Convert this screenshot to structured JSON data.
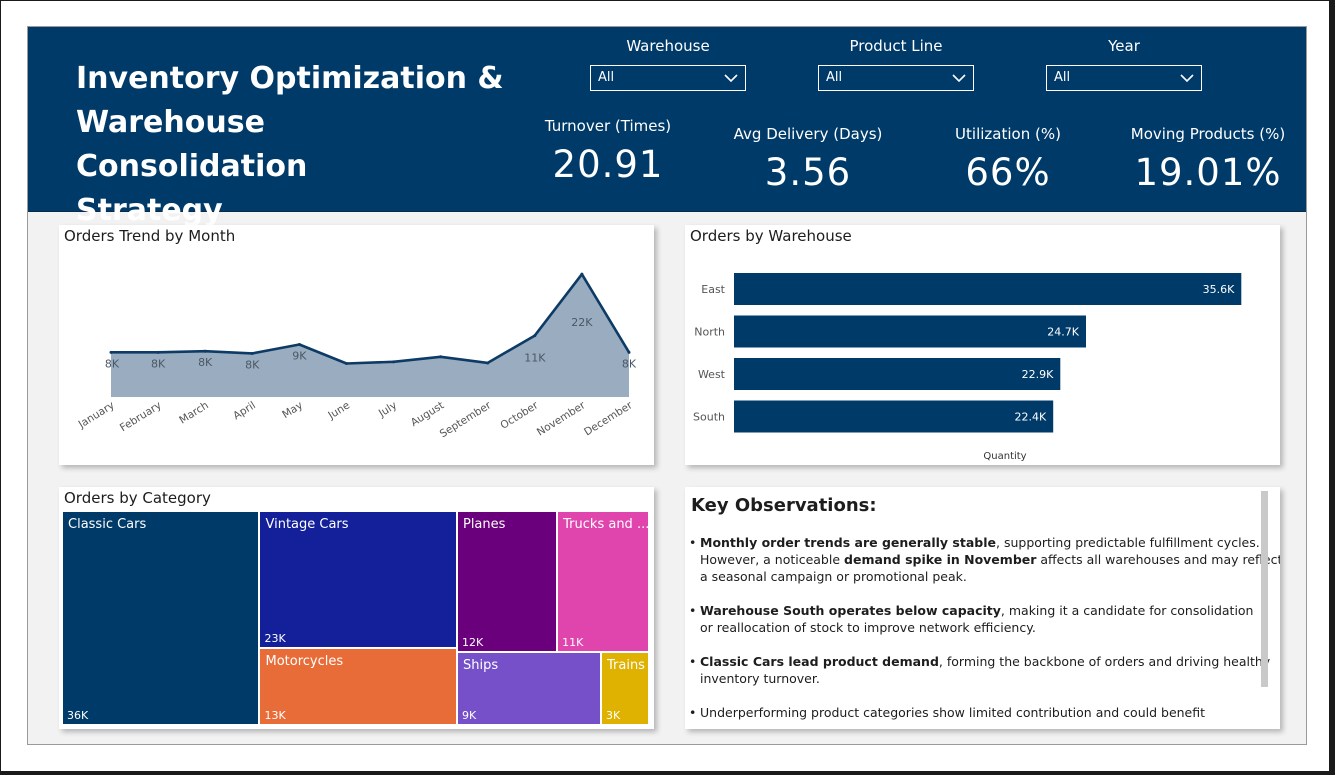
{
  "header": {
    "title_lines": [
      "Inventory Optimization &",
      "Warehouse Consolidation",
      "Strategy"
    ],
    "background_color": "#003a69"
  },
  "filters": [
    {
      "label": "Warehouse",
      "value": "All"
    },
    {
      "label": "Product Line",
      "value": "All"
    },
    {
      "label": "Year",
      "value": "All"
    }
  ],
  "kpis": [
    {
      "label": "Turnover (Times)",
      "value": "20.91"
    },
    {
      "label": "Avg Delivery (Days)",
      "value": "3.56"
    },
    {
      "label": "Utilization (%)",
      "value": "66%"
    },
    {
      "label": "Moving Products (%)",
      "value": "19.01%"
    }
  ],
  "trend": {
    "title": "Orders Trend by Month"
  },
  "warehouse": {
    "title": "Orders by Warehouse"
  },
  "category": {
    "title": "Orders by Category"
  },
  "chart_data": [
    {
      "type": "area",
      "title": "Orders Trend by Month",
      "categories": [
        "January",
        "February",
        "March",
        "April",
        "May",
        "June",
        "July",
        "August",
        "September",
        "October",
        "November",
        "December"
      ],
      "values": [
        8000,
        8000,
        8200,
        7800,
        9400,
        6000,
        6300,
        7200,
        6100,
        11000,
        22000,
        8000
      ],
      "data_labels": [
        "8K",
        "8K",
        "8K",
        "8K",
        "9K",
        "",
        "",
        "",
        "",
        "11K",
        "22K",
        "8K"
      ],
      "ylim": [
        0,
        24000
      ],
      "line_color": "#0d3b66",
      "fill_color": "#9aadc0"
    },
    {
      "type": "bar",
      "title": "Orders by Warehouse",
      "orientation": "horizontal",
      "categories": [
        "East",
        "North",
        "West",
        "South"
      ],
      "values": [
        35600,
        24700,
        22900,
        22400
      ],
      "data_labels": [
        "35.6K",
        "24.7K",
        "22.9K",
        "22.4K"
      ],
      "xlabel": "Quantity",
      "xlim": [
        0,
        36000
      ],
      "color": "#003a69"
    },
    {
      "type": "treemap",
      "title": "Orders by Category",
      "categories": [
        "Classic Cars",
        "Vintage Cars",
        "Motorcycles",
        "Planes",
        "Trucks and ...",
        "Ships",
        "Trains"
      ],
      "values": [
        36000,
        23000,
        13000,
        12000,
        11000,
        9000,
        3000
      ],
      "data_labels": [
        "36K",
        "23K",
        "13K",
        "12K",
        "11K",
        "9K",
        "3K"
      ],
      "colors": [
        "#003a69",
        "#13209a",
        "#e86c38",
        "#6b007c",
        "#e045ad",
        "#7650c8",
        "#dfb100"
      ]
    }
  ],
  "observations": {
    "title": "Key Observations:",
    "items": [
      {
        "lines": [
          [
            {
              "text": "Monthly order trends are generally stable",
              "bold": true
            },
            {
              "text": ", supporting predictable fulfillment cycles.",
              "bold": false
            }
          ],
          [
            {
              "text": "However, a noticeable ",
              "bold": false
            },
            {
              "text": "demand spike in November",
              "bold": true
            },
            {
              "text": " affects all warehouses and may reflect",
              "bold": false
            }
          ],
          [
            {
              "text": "a seasonal campaign or promotional peak.",
              "bold": false
            }
          ]
        ]
      },
      {
        "lines": [
          [
            {
              "text": "Warehouse South operates below capacity",
              "bold": true
            },
            {
              "text": ", making it a candidate for consolidation",
              "bold": false
            }
          ],
          [
            {
              "text": "or reallocation of stock to improve network efficiency.",
              "bold": false
            }
          ]
        ]
      },
      {
        "lines": [
          [
            {
              "text": "Classic Cars lead product demand",
              "bold": true
            },
            {
              "text": ", forming the backbone of orders and driving healthy",
              "bold": false
            }
          ],
          [
            {
              "text": "inventory turnover.",
              "bold": false
            }
          ]
        ]
      },
      {
        "lines": [
          [
            {
              "text": "Underperforming product categories show limited contribution and could benefit",
              "bold": false
            }
          ]
        ]
      }
    ]
  }
}
